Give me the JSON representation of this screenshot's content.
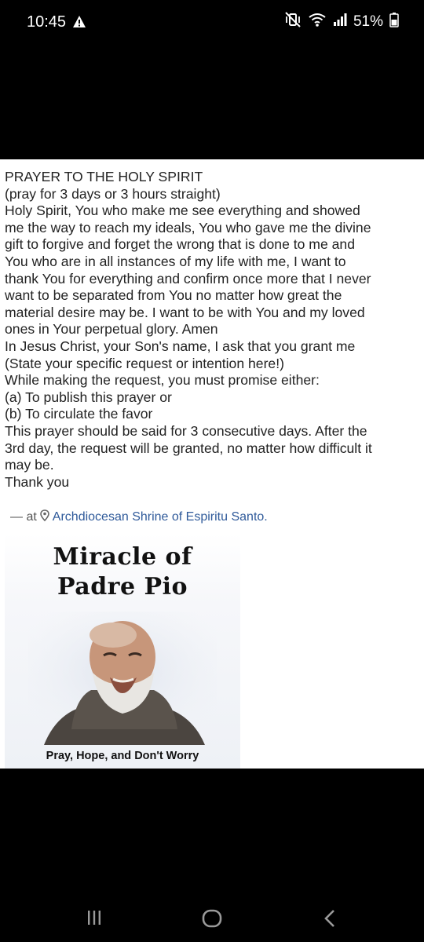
{
  "status_bar": {
    "time": "10:45",
    "battery": "51%"
  },
  "post": {
    "lines": [
      "PRAYER TO THE HOLY SPIRIT",
      "(pray for 3 days or 3 hours straight)",
      "Holy Spirit, You who make me see everything and showed",
      "me the way to reach my ideals, You who gave me the divine",
      "gift to forgive and forget the wrong that is done to me and",
      "You who are in all instances of my life with me, I want to",
      "thank You for everything and confirm once more that I never",
      "want to be separated from You no matter how great the",
      "material desire may be. I want to be with You and my loved",
      "ones in Your perpetual glory. Amen",
      "In Jesus Christ, your Son's name, I ask that you grant me",
      "(State your specific request or intention here!)",
      "While making the request, you must promise either:",
      "(a) To publish this prayer or",
      "(b) To circulate the favor",
      "This prayer should be said for 3 consecutive days. After the",
      "3rd day, the request will be granted, no matter how difficult it",
      "may be.",
      "Thank you"
    ],
    "checkin_prefix": "— at",
    "checkin_place": "Archdiocesan Shrine of Espiritu Santo."
  },
  "image_card": {
    "title_line1": "Miracle of",
    "title_line2": "Padre Pio",
    "caption": "Pray, Hope, and Don't Worry"
  },
  "icons": [
    "warning-icon",
    "mute-vibrate-icon",
    "wifi-icon",
    "signal-icon",
    "battery-icon",
    "location-pin-icon",
    "recent-apps-icon",
    "home-icon",
    "back-icon"
  ]
}
